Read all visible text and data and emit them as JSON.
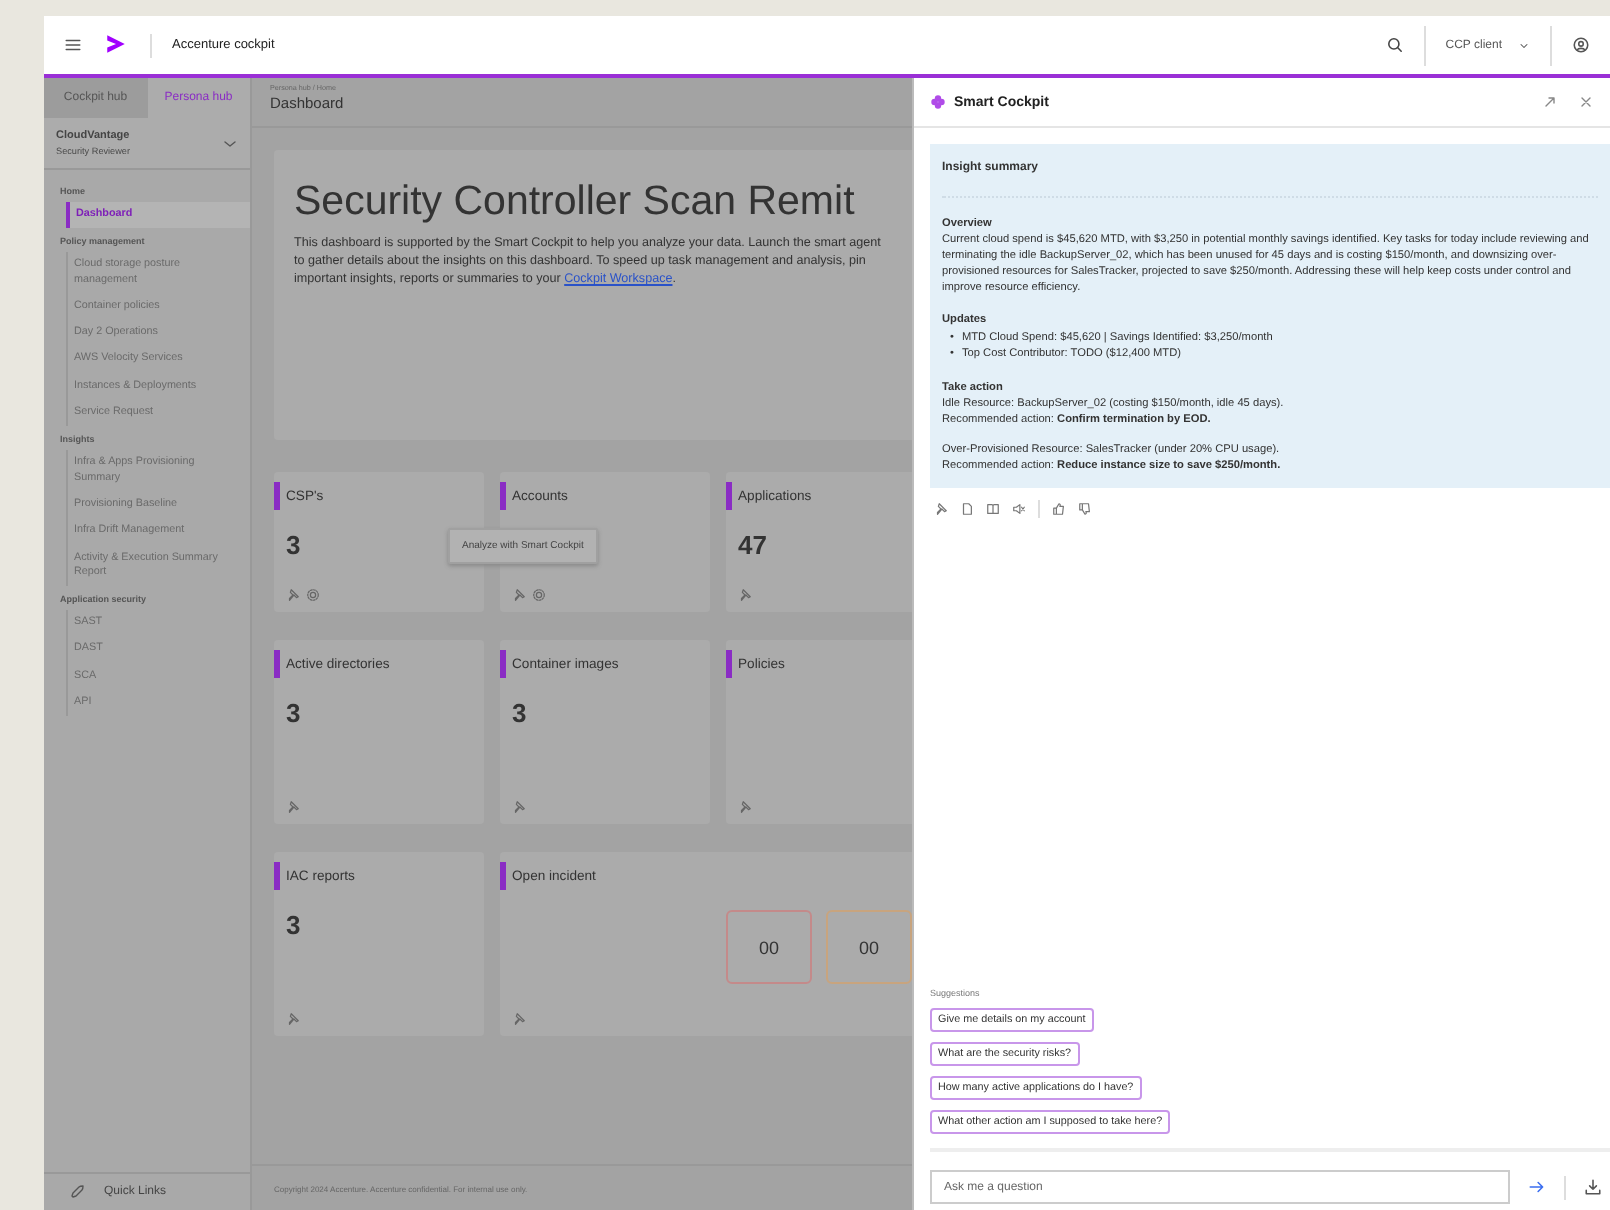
{
  "header": {
    "app_name": "Accenture cockpit",
    "client": "CCP client"
  },
  "sidebar": {
    "tabs": [
      {
        "label": "Cockpit hub",
        "selected": false
      },
      {
        "label": "Persona hub",
        "selected": true
      }
    ],
    "workspace": {
      "name": "CloudVantage",
      "role": "Security Reviewer"
    },
    "sections": [
      {
        "title": "Home",
        "items": [
          {
            "label": "Dashboard",
            "selected": true
          }
        ]
      },
      {
        "title": "Policy management",
        "items": [
          {
            "label": "Cloud storage posture management",
            "selected": false
          },
          {
            "label": "Container policies",
            "selected": false
          },
          {
            "label": "Day 2 Operations",
            "selected": false
          },
          {
            "label": "AWS Velocity Services",
            "selected": false
          },
          {
            "label": "Instances & Deployments",
            "selected": false
          },
          {
            "label": "Service Request",
            "selected": false
          }
        ]
      },
      {
        "title": "Insights",
        "items": [
          {
            "label": "Infra & Apps Provisioning Summary",
            "selected": false
          },
          {
            "label": "Provisioning Baseline",
            "selected": false
          },
          {
            "label": "Infra Drift Management",
            "selected": false
          },
          {
            "label": "Activity & Execution Summary Report",
            "selected": false
          }
        ]
      },
      {
        "title": "Application security",
        "items": [
          {
            "label": "SAST",
            "selected": false
          },
          {
            "label": "DAST",
            "selected": false
          },
          {
            "label": "SCA",
            "selected": false
          },
          {
            "label": "API",
            "selected": false
          }
        ]
      }
    ],
    "quick_links": "Quick Links"
  },
  "page": {
    "breadcrumb": "Persona hub / Home",
    "title": "Dashboard"
  },
  "hero": {
    "title": "Security Controller Scan Remit",
    "text": "This dashboard is supported by the Smart Cockpit to help you analyze your data. Launch the smart agent to gather details about the insights on this dashboard. To speed up task management and analysis, pin important insights, reports or summaries to your ",
    "link": "Cockpit Workspace",
    "text_after": "."
  },
  "cards": [
    {
      "kind": "stat",
      "title": "CSP's",
      "value": "3",
      "analyze_icon": true
    },
    {
      "kind": "stat",
      "title": "Accounts",
      "analyze_icon": true,
      "tooltip": "Analyze with Smart Cockpit"
    },
    {
      "kind": "stat",
      "title": "Applications",
      "value": "47",
      "analyze_icon": false
    },
    {
      "kind": "stat",
      "title": "Active directories",
      "value": "3",
      "analyze_icon": false
    },
    {
      "kind": "stat",
      "title": "Container images",
      "value": "3",
      "analyze_icon": false
    },
    {
      "kind": "stat",
      "title": "Policies",
      "analyze_icon": false
    },
    {
      "kind": "stat",
      "title": "IAC reports",
      "value": "3",
      "analyze_icon": false
    },
    {
      "kind": "incident",
      "title": "Open incident",
      "counts": [
        {
          "value": "00",
          "color": "#c48a8a"
        },
        {
          "value": "00",
          "color": "#c8a47e"
        }
      ]
    }
  ],
  "footer": "Copyright 2024 Accenture. Accenture confidential. For internal use only.",
  "assistant": {
    "title": "Smart Cockpit",
    "insight": {
      "title": "Insight summary",
      "sections": [
        {
          "kind": "paragraph",
          "heading": "Overview",
          "text": "Current cloud spend is $45,620 MTD, with $3,250 in potential monthly savings identified. Key tasks for today include reviewing and terminating the idle BackupServer_02, which has been unused for 45 days and is costing $150/month, and downsizing over-provisioned resources for SalesTracker, projected to save $250/month. Addressing these will help keep costs under control and improve resource efficiency."
        },
        {
          "kind": "bullets",
          "heading": "Updates",
          "items": [
            {
              "marker": "•",
              "text": "MTD Cloud Spend: $45,620 | Savings Identified: $3,250/month"
            },
            {
              "marker": "•",
              "text": "Top Cost Contributor: TODO ($12,400 MTD)"
            }
          ]
        },
        {
          "kind": "blocks",
          "heading": "Take action",
          "blocks": [
            [
              "Idle Resource: BackupServer_02 (costing $150/month, idle 45 days).",
              "Recommended action: **Confirm termination by EOD.**"
            ],
            [
              "Over-Provisioned Resource: SalesTracker (under 20% CPU usage).",
              "Recommended action: **Reduce instance size to save $250/month.**"
            ]
          ]
        }
      ]
    },
    "suggestions_label": "Suggestions",
    "suggestions": [
      "Give me details on my account",
      "What are the security risks?",
      "How many active applications do I have?",
      "What other action am I supposed to take here?"
    ],
    "input": {
      "placeholder": "Ask me a question"
    }
  }
}
